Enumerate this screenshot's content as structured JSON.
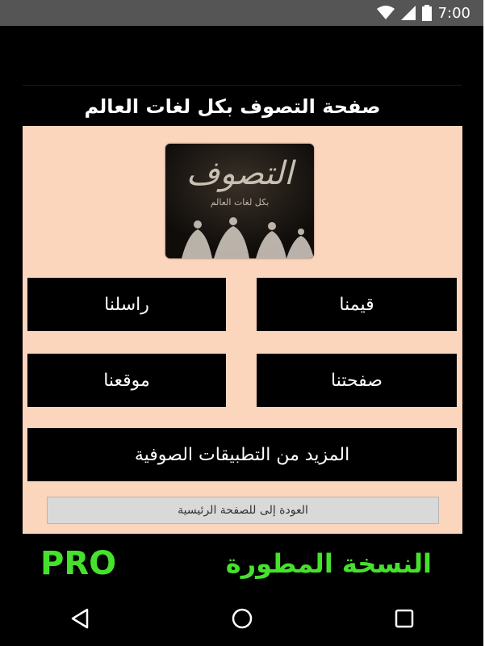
{
  "status_bar": {
    "time": "7:00",
    "icons": [
      "wifi-icon",
      "signal-icon",
      "battery-icon"
    ]
  },
  "header": {
    "title": "صفحة التصوف بكل لغات العالم"
  },
  "logo": {
    "icon": "sufi-logo-icon",
    "text": "التصوف",
    "subtitle": "بكل لغات العالم"
  },
  "buttons": {
    "contact": "راسلنا",
    "values": "قيمنا",
    "site": "موقعنا",
    "page": "صفحتنا",
    "more_apps": "المزيد من التطبيقات الصوفية",
    "back_home": "العودة إلى للصفحة الرئيسية"
  },
  "footer": {
    "pro_label": "PRO",
    "edition_label": "النسخة المطورة"
  },
  "navigation": {
    "back_icon": "back-triangle-icon",
    "home_icon": "home-circle-icon",
    "recent_icon": "recent-apps-square-icon"
  },
  "colors": {
    "panel_background": "#fcd5bd",
    "tile_background": "#000000",
    "pro_text": "#46e12d",
    "status_bar": "#555555"
  }
}
